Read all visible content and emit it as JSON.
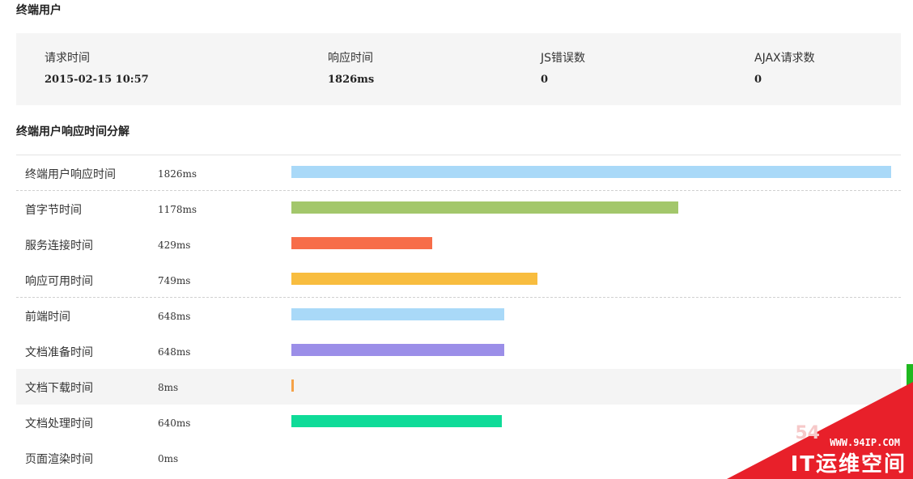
{
  "sections": {
    "end_user_title": "终端用户",
    "breakdown_title": "终端用户响应时间分解"
  },
  "summary": {
    "request_time": {
      "label": "请求时间",
      "value": "2015-02-15 10:57"
    },
    "response_time": {
      "label": "响应时间",
      "value": "1826ms"
    },
    "js_errors": {
      "label": "JS错误数",
      "value": "0"
    },
    "ajax_requests": {
      "label": "AJAX请求数",
      "value": "0"
    }
  },
  "breakdown": {
    "max_ms": 1826,
    "rows": [
      {
        "name": "终端用户响应时间",
        "ms_label": "1826ms",
        "ms": 1826,
        "color": "#a9d9f8"
      },
      {
        "name": "首字节时间",
        "ms_label": "1178ms",
        "ms": 1178,
        "color": "#a3c76b"
      },
      {
        "name": "服务连接时间",
        "ms_label": "429ms",
        "ms": 429,
        "color": "#f76d49"
      },
      {
        "name": "响应可用时间",
        "ms_label": "749ms",
        "ms": 749,
        "color": "#f8bd3f"
      },
      {
        "name": "前端时间",
        "ms_label": "648ms",
        "ms": 648,
        "color": "#a9d9f8"
      },
      {
        "name": "文档准备时间",
        "ms_label": "648ms",
        "ms": 648,
        "color": "#9b8ee8"
      },
      {
        "name": "文档下载时间",
        "ms_label": "8ms",
        "ms": 8,
        "color": "#f5a247"
      },
      {
        "name": "文档处理时间",
        "ms_label": "640ms",
        "ms": 640,
        "color": "#0fdb98"
      },
      {
        "name": "页面渲染时间",
        "ms_label": "0ms",
        "ms": 0,
        "color": "#a9d9f8"
      }
    ]
  },
  "watermark": {
    "site": "WWW.94IP.COM",
    "brand": "IT运维空间",
    "ghost": "54"
  }
}
